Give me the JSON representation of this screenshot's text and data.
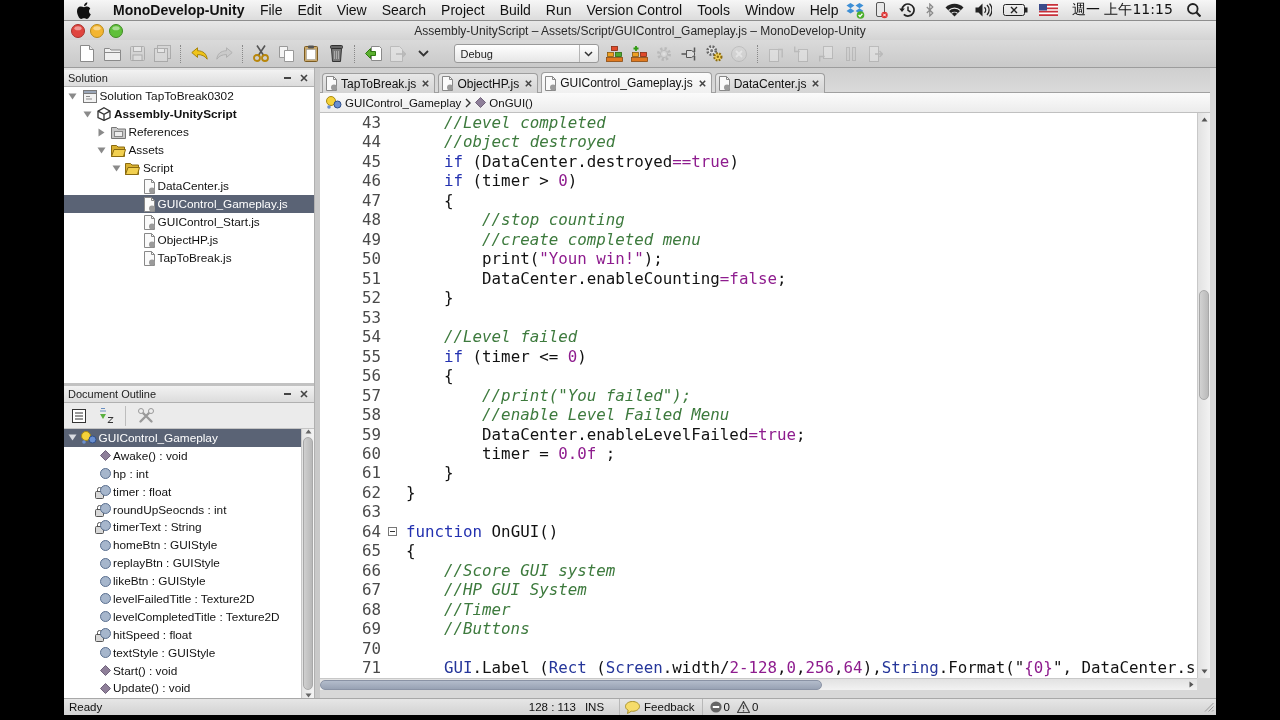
{
  "menu_bar": {
    "app_name": "MonoDevelop-Unity",
    "menus": [
      "File",
      "Edit",
      "View",
      "Search",
      "Project",
      "Build",
      "Run",
      "Version Control",
      "Tools",
      "Window",
      "Help"
    ],
    "clock": "週一 上午11:15"
  },
  "window": {
    "title": "Assembly-UnityScript – Assets/Script/GUIControl_Gameplay.js – MonoDevelop-Unity"
  },
  "toolbar": [
    {
      "kind": "new",
      "disabled": false
    },
    {
      "kind": "open",
      "disabled": false
    },
    {
      "kind": "save",
      "disabled": true
    },
    {
      "kind": "saveall",
      "disabled": true
    },
    {
      "kind": "separator"
    },
    {
      "kind": "undo",
      "disabled": false
    },
    {
      "kind": "redo",
      "disabled": true
    },
    {
      "kind": "separator"
    },
    {
      "kind": "cut",
      "disabled": false
    },
    {
      "kind": "copy",
      "disabled": false
    },
    {
      "kind": "paste",
      "disabled": false
    },
    {
      "kind": "delete",
      "disabled": false
    },
    {
      "kind": "separator"
    },
    {
      "kind": "import",
      "disabled": false
    },
    {
      "kind": "export",
      "disabled": true
    },
    {
      "kind": "more",
      "disabled": false
    },
    {
      "kind": "select",
      "value": "Debug"
    },
    {
      "kind": "build",
      "disabled": false
    },
    {
      "kind": "buildall",
      "disabled": false
    },
    {
      "kind": "gear",
      "disabled": true
    },
    {
      "kind": "plug",
      "disabled": false
    },
    {
      "kind": "cogs",
      "disabled": false
    },
    {
      "kind": "stop",
      "disabled": true
    },
    {
      "kind": "separator"
    },
    {
      "kind": "stepover",
      "disabled": true
    },
    {
      "kind": "stepinto",
      "disabled": true
    },
    {
      "kind": "stepout",
      "disabled": true
    },
    {
      "kind": "pause",
      "disabled": true
    },
    {
      "kind": "runto",
      "disabled": true
    }
  ],
  "solution_panel": {
    "title": "Solution",
    "tree": [
      {
        "kind": "solution",
        "label": "Solution TapToBreak0302",
        "expanded": true,
        "selected": false,
        "children": [
          {
            "kind": "project",
            "label": "Assembly-UnityScript",
            "expanded": true,
            "selected": false,
            "children": [
              {
                "kind": "references",
                "label": "References",
                "expanded": false,
                "selected": false
              },
              {
                "kind": "folder",
                "label": "Assets",
                "expanded": true,
                "selected": false,
                "children": [
                  {
                    "kind": "folder",
                    "label": "Script",
                    "expanded": true,
                    "selected": false,
                    "children": [
                      {
                        "kind": "file",
                        "label": "DataCenter.js",
                        "selected": false
                      },
                      {
                        "kind": "file",
                        "label": "GUIControl_Gameplay.js",
                        "selected": true
                      },
                      {
                        "kind": "file",
                        "label": "GUIControl_Start.js",
                        "selected": false
                      },
                      {
                        "kind": "file",
                        "label": "ObjectHP.js",
                        "selected": false
                      },
                      {
                        "kind": "file",
                        "label": "TapToBreak.js",
                        "selected": false
                      }
                    ]
                  }
                ]
              }
            ]
          }
        ]
      }
    ]
  },
  "outline_panel": {
    "title": "Document Outline",
    "tree": [
      {
        "kind": "class",
        "label": "GUIControl_Gameplay",
        "expanded": true,
        "selected": true,
        "children": [
          {
            "kind": "method",
            "label": "Awake() : void",
            "selected": false
          },
          {
            "kind": "field",
            "label": "hp : int",
            "selected": false
          },
          {
            "kind": "private",
            "label": "timer : float",
            "selected": false
          },
          {
            "kind": "private",
            "label": "roundUpSeocnds : int",
            "selected": false
          },
          {
            "kind": "private",
            "label": "timerText : String",
            "selected": false
          },
          {
            "kind": "field",
            "label": "homeBtn : GUIStyle",
            "selected": false
          },
          {
            "kind": "field",
            "label": "replayBtn : GUIStyle",
            "selected": false
          },
          {
            "kind": "field",
            "label": "likeBtn : GUIStyle",
            "selected": false
          },
          {
            "kind": "field",
            "label": "levelFailedTitle : Texture2D",
            "selected": false
          },
          {
            "kind": "field",
            "label": "levelCompletedTitle : Texture2D",
            "selected": false
          },
          {
            "kind": "private",
            "label": "hitSpeed : float",
            "selected": false
          },
          {
            "kind": "field",
            "label": "textStyle : GUIStyle",
            "selected": false
          },
          {
            "kind": "method",
            "label": "Start() : void",
            "selected": false
          },
          {
            "kind": "method",
            "label": "Update() : void",
            "selected": false
          }
        ]
      }
    ]
  },
  "editor": {
    "tabs": [
      {
        "label": "TapToBreak.js",
        "selected": false
      },
      {
        "label": "ObjectHP.js",
        "selected": false
      },
      {
        "label": "GUIControl_Gameplay.js",
        "selected": true
      },
      {
        "label": "DataCenter.js",
        "selected": false
      }
    ],
    "breadcrumb": [
      {
        "kind": "class",
        "label": "GUIControl_Gameplay"
      },
      {
        "kind": "method",
        "label": "OnGUI()"
      }
    ],
    "lines": [
      {
        "number": "43",
        "tokens": [
          {
            "kind": "comment",
            "text": "    //Level completed"
          }
        ]
      },
      {
        "number": "44",
        "tokens": [
          {
            "kind": "comment",
            "text": "    //object destroyed"
          }
        ]
      },
      {
        "number": "45",
        "tokens": [
          {
            "kind": "keyword",
            "text": "    if"
          },
          {
            "kind": "plain",
            "text": " (DataCenter.destroyed"
          },
          {
            "kind": "literal",
            "text": "==true"
          },
          {
            "kind": "plain",
            "text": ")"
          }
        ]
      },
      {
        "number": "46",
        "tokens": [
          {
            "kind": "keyword",
            "text": "    if"
          },
          {
            "kind": "plain",
            "text": " (timer > "
          },
          {
            "kind": "literal",
            "text": "0"
          },
          {
            "kind": "plain",
            "text": ")"
          }
        ]
      },
      {
        "number": "47",
        "tokens": [
          {
            "kind": "plain",
            "text": "    {"
          }
        ]
      },
      {
        "number": "48",
        "tokens": [
          {
            "kind": "comment",
            "text": "        //stop counting"
          }
        ]
      },
      {
        "number": "49",
        "tokens": [
          {
            "kind": "comment",
            "text": "        //create completed menu"
          }
        ]
      },
      {
        "number": "50",
        "tokens": [
          {
            "kind": "plain",
            "text": "        print("
          },
          {
            "kind": "literal",
            "text": "\"Youn win!\""
          },
          {
            "kind": "plain",
            "text": ");"
          }
        ]
      },
      {
        "number": "51",
        "tokens": [
          {
            "kind": "plain",
            "text": "        DataCenter.enableCounting"
          },
          {
            "kind": "literal",
            "text": "=false"
          },
          {
            "kind": "plain",
            "text": ";"
          }
        ]
      },
      {
        "number": "52",
        "tokens": [
          {
            "kind": "plain",
            "text": "    }"
          }
        ]
      },
      {
        "number": "53"
      },
      {
        "number": "54",
        "tokens": [
          {
            "kind": "comment",
            "text": "    //Level failed"
          }
        ]
      },
      {
        "number": "55",
        "tokens": [
          {
            "kind": "keyword",
            "text": "    if"
          },
          {
            "kind": "plain",
            "text": " (timer <= "
          },
          {
            "kind": "literal",
            "text": "0"
          },
          {
            "kind": "plain",
            "text": ")"
          }
        ]
      },
      {
        "number": "56",
        "tokens": [
          {
            "kind": "plain",
            "text": "    {"
          }
        ]
      },
      {
        "number": "57",
        "tokens": [
          {
            "kind": "comment",
            "text": "        //print(\"You failed\");"
          }
        ]
      },
      {
        "number": "58",
        "tokens": [
          {
            "kind": "comment",
            "text": "        //enable Level Failed Menu"
          }
        ]
      },
      {
        "number": "59",
        "tokens": [
          {
            "kind": "plain",
            "text": "        DataCenter.enableLevelFailed"
          },
          {
            "kind": "literal",
            "text": "=true"
          },
          {
            "kind": "plain",
            "text": ";"
          }
        ]
      },
      {
        "number": "60",
        "tokens": [
          {
            "kind": "plain",
            "text": "        timer = "
          },
          {
            "kind": "literal",
            "text": "0.0f"
          },
          {
            "kind": "plain",
            "text": " ;"
          }
        ]
      },
      {
        "number": "61",
        "tokens": [
          {
            "kind": "plain",
            "text": "    }"
          }
        ]
      },
      {
        "number": "62",
        "tokens": [
          {
            "kind": "plain",
            "text": "}"
          }
        ]
      },
      {
        "number": "63"
      },
      {
        "number": "64",
        "expanded": true,
        "tokens": [
          {
            "kind": "keyword",
            "text": "function"
          },
          {
            "kind": "plain",
            "text": " OnGUI()"
          }
        ]
      },
      {
        "number": "65",
        "tokens": [
          {
            "kind": "plain",
            "text": "{"
          }
        ]
      },
      {
        "number": "66",
        "tokens": [
          {
            "kind": "comment",
            "text": "    //Score GUI system"
          }
        ]
      },
      {
        "number": "67",
        "tokens": [
          {
            "kind": "comment",
            "text": "    //HP GUI System"
          }
        ]
      },
      {
        "number": "68",
        "tokens": [
          {
            "kind": "comment",
            "text": "    //Timer"
          }
        ]
      },
      {
        "number": "69",
        "tokens": [
          {
            "kind": "comment",
            "text": "    //Buttons"
          }
        ]
      },
      {
        "number": "70"
      },
      {
        "number": "71",
        "tokens": [
          {
            "kind": "type",
            "text": "    GUI"
          },
          {
            "kind": "plain",
            "text": ".Label ("
          },
          {
            "kind": "type",
            "text": "Rect"
          },
          {
            "kind": "plain",
            "text": " ("
          },
          {
            "kind": "type",
            "text": "Screen"
          },
          {
            "kind": "plain",
            "text": ".width/"
          },
          {
            "kind": "literal",
            "text": "2-128"
          },
          {
            "kind": "plain",
            "text": ","
          },
          {
            "kind": "literal",
            "text": "0"
          },
          {
            "kind": "plain",
            "text": ","
          },
          {
            "kind": "literal",
            "text": "256"
          },
          {
            "kind": "plain",
            "text": ","
          },
          {
            "kind": "literal",
            "text": "64"
          },
          {
            "kind": "plain",
            "text": "),"
          },
          {
            "kind": "type",
            "text": "String"
          },
          {
            "kind": "plain",
            "text": ".Format(\""
          },
          {
            "kind": "literal",
            "text": "{0}"
          },
          {
            "kind": "plain",
            "text": "\", DataCenter.s"
          }
        ]
      }
    ]
  },
  "status_bar": {
    "message": "Ready",
    "position": "128 : 113",
    "mode": "INS",
    "feedback": "Feedback",
    "errors": "0",
    "warnings": "0"
  }
}
